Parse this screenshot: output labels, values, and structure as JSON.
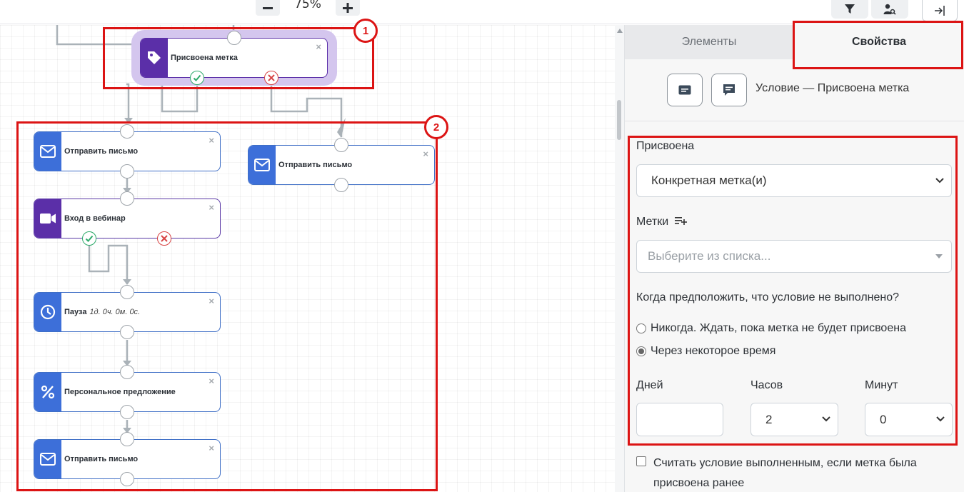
{
  "toolbar": {
    "zoom_out": "−",
    "zoom_level": "75%",
    "zoom_in": "+",
    "filter_icon": "filter-icon",
    "user_search_icon": "user-search-icon",
    "exit_icon": "sidebar-toggle-icon"
  },
  "canvas": {
    "tag_node": {
      "title": "Присвоена метка",
      "icon": "tag-icon"
    },
    "nodes": [
      {
        "title": "Отправить письмо",
        "icon": "mail-icon"
      },
      {
        "title": "Вход в вебинар",
        "icon": "video-icon"
      },
      {
        "title": "Пауза",
        "detail": "1д. 0ч. 0м. 0с.",
        "icon": "clock-icon"
      },
      {
        "title": "Персональное предложение",
        "icon": "percent-icon"
      },
      {
        "title": "Отправить письмо",
        "icon": "mail-icon"
      },
      {
        "title": "Отправить письмо",
        "icon": "mail-icon"
      }
    ],
    "close_glyph": "×",
    "annotations": [
      "1",
      "2"
    ]
  },
  "panel": {
    "tabs": [
      "Элементы",
      "Свойства"
    ],
    "active_tab": "Свойства",
    "condition_title": "Условие — Присвоена метка",
    "assigned_label": "Присвоена",
    "assigned_value": "Конкретная метка(и)",
    "tags_label": "Метки",
    "tags_placeholder": "Выберите из списка...",
    "question": "Когда предположить, что условие не выполнено?",
    "radio_never": "Никогда. Ждать, пока метка не будет присвоена",
    "radio_after": "Через некоторое время",
    "radio_selected": "radio_after",
    "days_label": "Дней",
    "days_value": "",
    "hours_label": "Часов",
    "hours_value": "2",
    "minutes_label": "Минут",
    "minutes_value": "0",
    "checkbox_label": "Считать условие выполненным, если метка была присвоена ранее"
  },
  "colors": {
    "highlight": "#dc1414",
    "mail_node": "#3d6fd9",
    "purple_node": "#5b2fa8",
    "ok_port": "#2eaa6b",
    "fail_port": "#d84444"
  }
}
